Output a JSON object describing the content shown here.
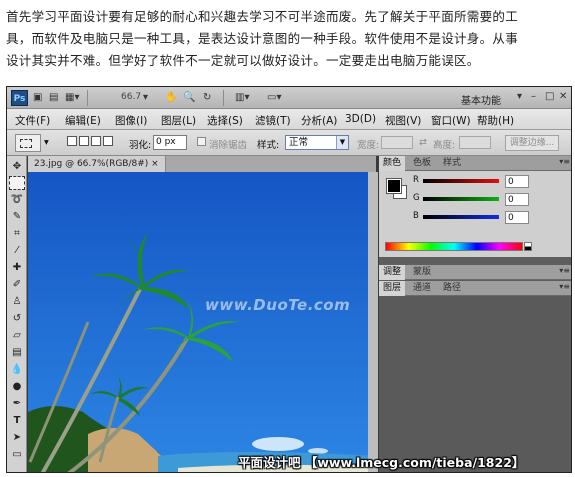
{
  "intro_lines": [
    "首先学习平面设计要有足够的耐心和兴趣去学习不可半途而废。先了解关于平面所需要的工",
    "具，而软件及电脑只是一种工具，是表达设计意图的一种手段。软件使用不是设计身。从事",
    "设计其实并不难。但学好了软件不一定就可以做好设计。一定要走出电脑万能误区。"
  ],
  "appbar": {
    "logo": "Ps",
    "zoom": "66.7",
    "workspace": "基本功能",
    "window_controls": [
      "–",
      "□",
      "✕"
    ]
  },
  "menu": [
    "文件(F)",
    "编辑(E)",
    "图像(I)",
    "图层(L)",
    "选择(S)",
    "滤镜(T)",
    "分析(A)",
    "3D(D)",
    "视图(V)",
    "窗口(W)",
    "帮助(H)"
  ],
  "options": {
    "feather_label": "羽化:",
    "feather_value": "0 px",
    "antialias_label": "消除锯齿",
    "style_label": "样式:",
    "style_value": "正常",
    "width_label": "宽度:",
    "height_label": "高度:",
    "refine_edge": "调整边缘..."
  },
  "document": {
    "tab": "23.jpg @ 66.7%(RGB/8#)",
    "tab_close": "×"
  },
  "panels": {
    "color_tabs": [
      "颜色",
      "色板",
      "样式"
    ],
    "channels": [
      {
        "label": "R",
        "value": "0",
        "color": "#e01010"
      },
      {
        "label": "G",
        "value": "0",
        "color": "#10b010"
      },
      {
        "label": "B",
        "value": "0",
        "color": "#1030e0"
      }
    ],
    "adjust_tabs": [
      "调整",
      "蒙版"
    ],
    "layer_tabs": [
      "图层",
      "通道",
      "路径"
    ]
  },
  "watermarks": {
    "canvas": "www.DuoTe.com",
    "footer": "平面设计吧 【www.lmecg.com/tieba/1822】"
  },
  "icons": {
    "tools": [
      "move-icon",
      "marquee-icon",
      "lasso-icon",
      "quick-select-icon",
      "crop-icon",
      "eyedropper-icon",
      "healing-brush-icon",
      "brush-icon",
      "clone-stamp-icon",
      "history-brush-icon",
      "eraser-icon",
      "gradient-icon",
      "blur-icon",
      "dodge-icon",
      "pen-icon",
      "type-icon",
      "path-select-icon",
      "shape-icon"
    ]
  }
}
